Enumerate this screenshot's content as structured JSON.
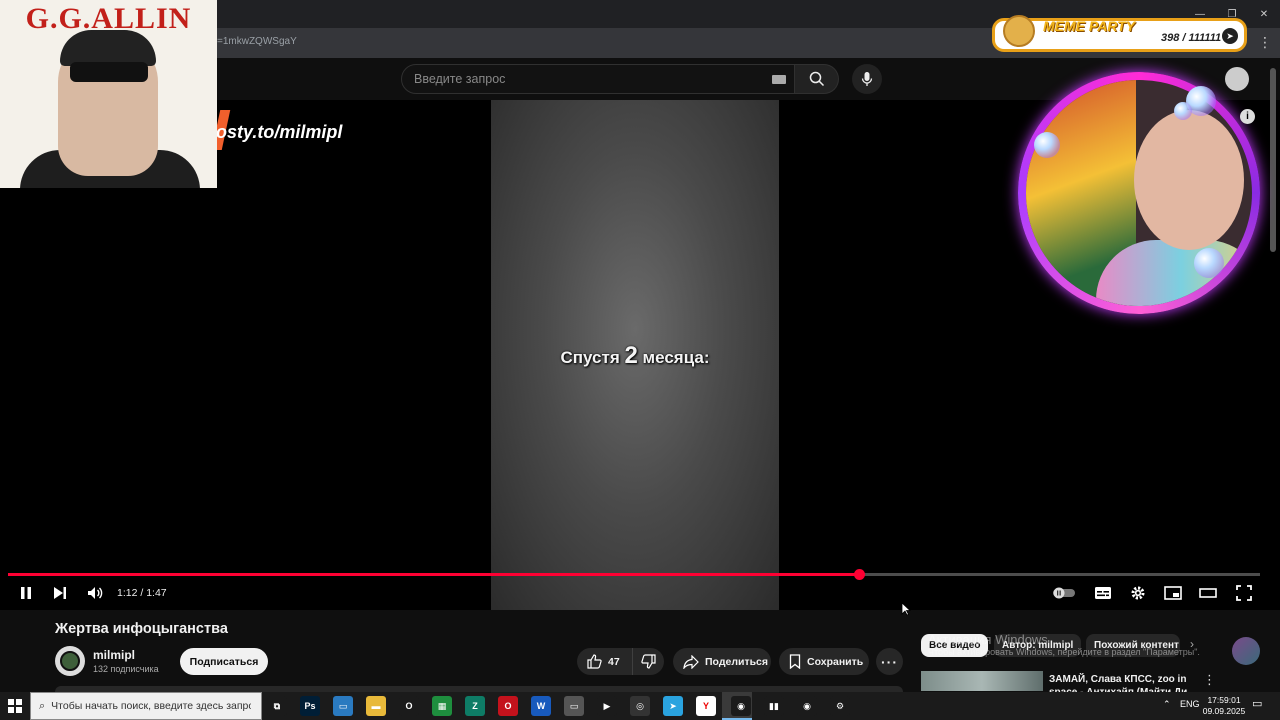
{
  "browser": {
    "url_fragment": "v=1mkwZQWSgaY",
    "window_controls": [
      "—",
      "❐",
      "✕"
    ]
  },
  "masthead": {
    "search_placeholder": "Введите запрос"
  },
  "player": {
    "overlay_text_pre": "Спустя ",
    "overlay_text_num": "2",
    "overlay_text_post": " месяца:",
    "watermark": "osty.to/milmipl",
    "current_time": "1:12",
    "duration": "1:47",
    "time_display": "1:12 / 1:47",
    "progress_fraction": 0.68
  },
  "overlays": {
    "poster_title": "G.G.ALLIN",
    "meme_party_title": "MEME PARTY",
    "meme_party_count": "398 / 111111"
  },
  "video": {
    "title": "Жертва инфоцыганства",
    "channel_name": "milmipl",
    "subscribers": "132 подписчика",
    "subscribe_label": "Подписаться",
    "like_count": "47",
    "share_label": "Поделиться",
    "save_label": "Сохранить"
  },
  "sidebar": {
    "chips": [
      "Все видео",
      "Автор: milmipl",
      "Похожий контент"
    ],
    "recommendation_title": "ЗАМАЙ, Слава КПСС, zoo in space - Антихайп (Майти Ди"
  },
  "windows_activation": {
    "line1": "Активация Windows",
    "line2": "Чтобы активировать Windows, перейдите в раздел \"Параметры\"."
  },
  "taskbar": {
    "search_placeholder": "Чтобы начать поиск, введите здесь запрос",
    "language": "ENG",
    "time": "17:59:01",
    "date": "09.09.2025",
    "apps": [
      {
        "name": "task-view-icon",
        "color": "#1b1b1b",
        "glyph": "⧉"
      },
      {
        "name": "photoshop-icon",
        "color": "#001e36",
        "glyph": "Ps"
      },
      {
        "name": "screen-icon",
        "color": "#2a7ac0",
        "glyph": "▭"
      },
      {
        "name": "folder-icon",
        "color": "#e8b93a",
        "glyph": "▬"
      },
      {
        "name": "opera-gx-icon",
        "color": "#1b1b1b",
        "glyph": "O"
      },
      {
        "name": "sheets-icon",
        "color": "#1e8e3e",
        "glyph": "▦"
      },
      {
        "name": "notes-icon",
        "color": "#0e7c66",
        "glyph": "Z"
      },
      {
        "name": "opera-icon",
        "color": "#c4121c",
        "glyph": "O"
      },
      {
        "name": "word-icon",
        "color": "#185abd",
        "glyph": "W"
      },
      {
        "name": "app-window-icon",
        "color": "#555",
        "glyph": "▭"
      },
      {
        "name": "play-store-icon",
        "color": "#1b1b1b",
        "glyph": "▶"
      },
      {
        "name": "browser-icon",
        "color": "#333",
        "glyph": "◎"
      },
      {
        "name": "telegram-icon",
        "color": "#2aa3df",
        "glyph": "➤"
      },
      {
        "name": "yandex-icon",
        "color": "#fff",
        "glyph": "Y"
      },
      {
        "name": "chrome-icon",
        "color": "#1b1b1b",
        "glyph": "◉"
      },
      {
        "name": "bars-app-icon",
        "color": "#1b1b1b",
        "glyph": "▮▮"
      },
      {
        "name": "chrome-alt-icon",
        "color": "#1b1b1b",
        "glyph": "◉"
      },
      {
        "name": "steam-like-icon",
        "color": "#1b1b1b",
        "glyph": "⚙"
      }
    ]
  }
}
